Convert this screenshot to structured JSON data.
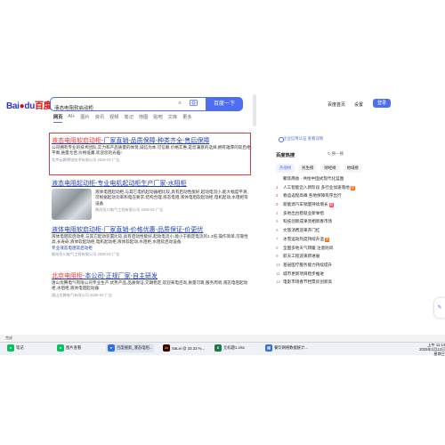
{
  "header": {
    "logo_main": "Bai",
    "logo_red": "du",
    "logo_cn": "百度",
    "query": "液态电阻软启动柜",
    "clear_glyph": "×",
    "search_button": "百度一下",
    "settings_link": "百度首页",
    "settings2": "设置",
    "login": "登录"
  },
  "tabs": [
    "网页",
    "AI+",
    "图片",
    "资讯",
    "视频",
    "笔记",
    "地图",
    "贴吧",
    "文库",
    "更多"
  ],
  "results": [
    {
      "title_hl": "液态电阻软启动柜",
      "title_rest": "-厂家直销-品质保障-种类齐全-售后保障",
      "text": "公司拥有专业的技术团队,实力和产品质量的体现,诚信为本,可信赖.价格实惠,是您满意的选择,拥有雄厚的软启柜,平衡,质量尤佳,价格低廉,欢迎您的光临!",
      "source": "北京云腾博锐技术有限公司 2025-02",
      "ad": "广告"
    },
    {
      "title": "液态电阻起动柜-专业电机起动柜生产厂家-水阻柜",
      "text": "液体电阻起动柜,与其它电机起动器相比较,具有启动性能好,起动电流小,能大幅度平滑,可根据起动功率和电压要求,结构合理,液态电阻,液体电阻软起动柜,电机起动,水阻柜等设备",
      "source": "衡阳恒川电气工程有限公司 2025-02",
      "ad": "广告"
    },
    {
      "title": "液体电阻软启动柜-厂家直销-价格优惠-品质保证-价更优",
      "text": "液体电阻软启动柜,与其它起动装置比较,具有启动性能好,起动电流小,能小于额定电流的1.3倍,操作简单,可靠性高,长寿命,液体软起动柜,电机起动柜,液体软起动,水阻柜,水阻软启动设备",
      "source": "衡阳恒川电气工程有限公司 2025-02",
      "extra": "专业液态电阻软启动柜",
      "ad": "广告"
    },
    {
      "title_hl": "北京电阻柜",
      "title_rest": "-本公司-正规厂家-自主研发",
      "text": "唐山优腾电气有限公司专业生产,优势产品,品质保证,交期稳定,欢迎来电咨询,质量可靠,服务周到,液态电阻起动柜,水阻柜,液体电阻起动器",
      "source": "唐山优腾电气有限公司 2025-02",
      "ad": "广告"
    }
  ],
  "right": {
    "enterprise_badge": "企业信用认证 查看详情",
    "hot_title": "百度热搜",
    "refresh": "换一换",
    "chips": [
      "热搜榜",
      "民生榜",
      "财经榜",
      "地域榜"
    ],
    "hotlist": [
      {
        "n": "",
        "text": "聚焦两会 · 共绘中国式现代化蓝图",
        "tag": ""
      },
      {
        "n": "1",
        "text": "人工智能迈入新阶段 多行业加速落地",
        "tag": "热"
      },
      {
        "n": "2",
        "text": "春运返程高峰 各地保障有序出行",
        "tag": ""
      },
      {
        "n": "3",
        "text": "新能源汽车销量持续增长",
        "tag": "新"
      },
      {
        "n": "4",
        "text": "多地出台稳就业新举措",
        "tag": ""
      },
      {
        "n": "5",
        "text": "科技创新成果亮相新春市场",
        "tag": ""
      },
      {
        "n": "6",
        "text": "文旅消费迎来开门红",
        "tag": ""
      },
      {
        "n": "7",
        "text": "冰雪运动热度持续升温",
        "tag": "热"
      },
      {
        "n": "8",
        "text": "全国多地天气转暖 注意防风",
        "tag": ""
      },
      {
        "n": "9",
        "text": "航天工程迎来新进展",
        "tag": ""
      },
      {
        "n": "10",
        "text": "基层医疗服务能力持续提升",
        "tag": ""
      },
      {
        "n": "11",
        "text": "城市更新项目稳步推进",
        "tag": ""
      },
      {
        "n": "12",
        "text": "电影市场春节档票房创新高",
        "tag": ""
      }
    ]
  },
  "statusbar": "完成",
  "taskbar": {
    "items": [
      "笔记",
      "图片查看",
      "百度搜索_液态电阻...",
      "SaLei @ 33.33 %...",
      "无标题1.xlsx",
      "餐饮网络数据统计..."
    ],
    "time": "上午 11:14",
    "date": "2025年2月12日 星期三"
  },
  "colors": {
    "accent": "#4e6ef2",
    "highlight_box": "#e53935",
    "link": "#2440b3",
    "match": "#f73131"
  }
}
